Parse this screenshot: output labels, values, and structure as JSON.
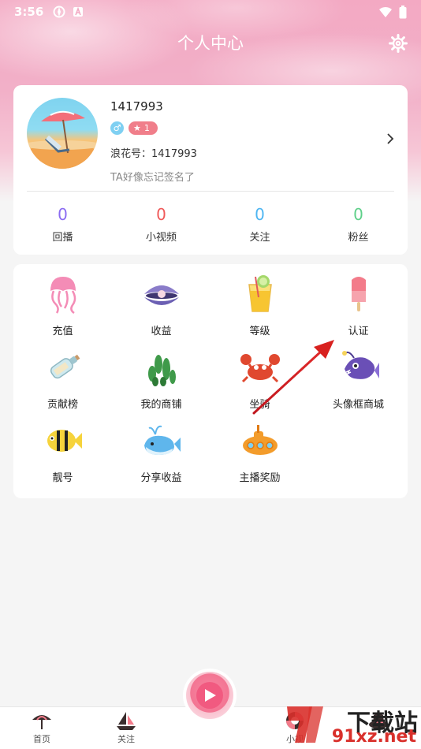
{
  "status_bar": {
    "time": "3:56"
  },
  "header": {
    "title": "个人中心"
  },
  "profile": {
    "username": "1417993",
    "gender_symbol": "♂",
    "level": "1",
    "id_label": "浪花号：1417993",
    "signature": "TA好像忘记签名了"
  },
  "stats": [
    {
      "value": "0",
      "label": "回播",
      "color": "#8b6cf2"
    },
    {
      "value": "0",
      "label": "小视频",
      "color": "#f05a5a"
    },
    {
      "value": "0",
      "label": "关注",
      "color": "#4fb6f2"
    },
    {
      "value": "0",
      "label": "粉丝",
      "color": "#5fd08a"
    }
  ],
  "menu": [
    {
      "label": "充值",
      "icon": "jellyfish-icon"
    },
    {
      "label": "收益",
      "icon": "clam-pearl-icon"
    },
    {
      "label": "等级",
      "icon": "juice-cup-icon"
    },
    {
      "label": "认证",
      "icon": "popsicle-icon"
    },
    {
      "label": "贡献榜",
      "icon": "message-bottle-icon"
    },
    {
      "label": "我的商铺",
      "icon": "seaweed-icon"
    },
    {
      "label": "坐骑",
      "icon": "crab-icon"
    },
    {
      "label": "头像框商城",
      "icon": "anglerfish-icon"
    },
    {
      "label": "靓号",
      "icon": "striped-fish-icon"
    },
    {
      "label": "分享收益",
      "icon": "whale-icon"
    },
    {
      "label": "主播奖励",
      "icon": "submarine-icon"
    }
  ],
  "tabbar": {
    "items": [
      {
        "label": "首页",
        "icon": "umbrella-icon"
      },
      {
        "label": "关注",
        "icon": "sailboat-icon"
      },
      {
        "label": "小视",
        "icon": "lifebuoy-icon"
      },
      {
        "label": "",
        "icon": "hat-icon"
      }
    ]
  },
  "watermark": {
    "line1": "下载站",
    "line2": "91xz.net"
  }
}
